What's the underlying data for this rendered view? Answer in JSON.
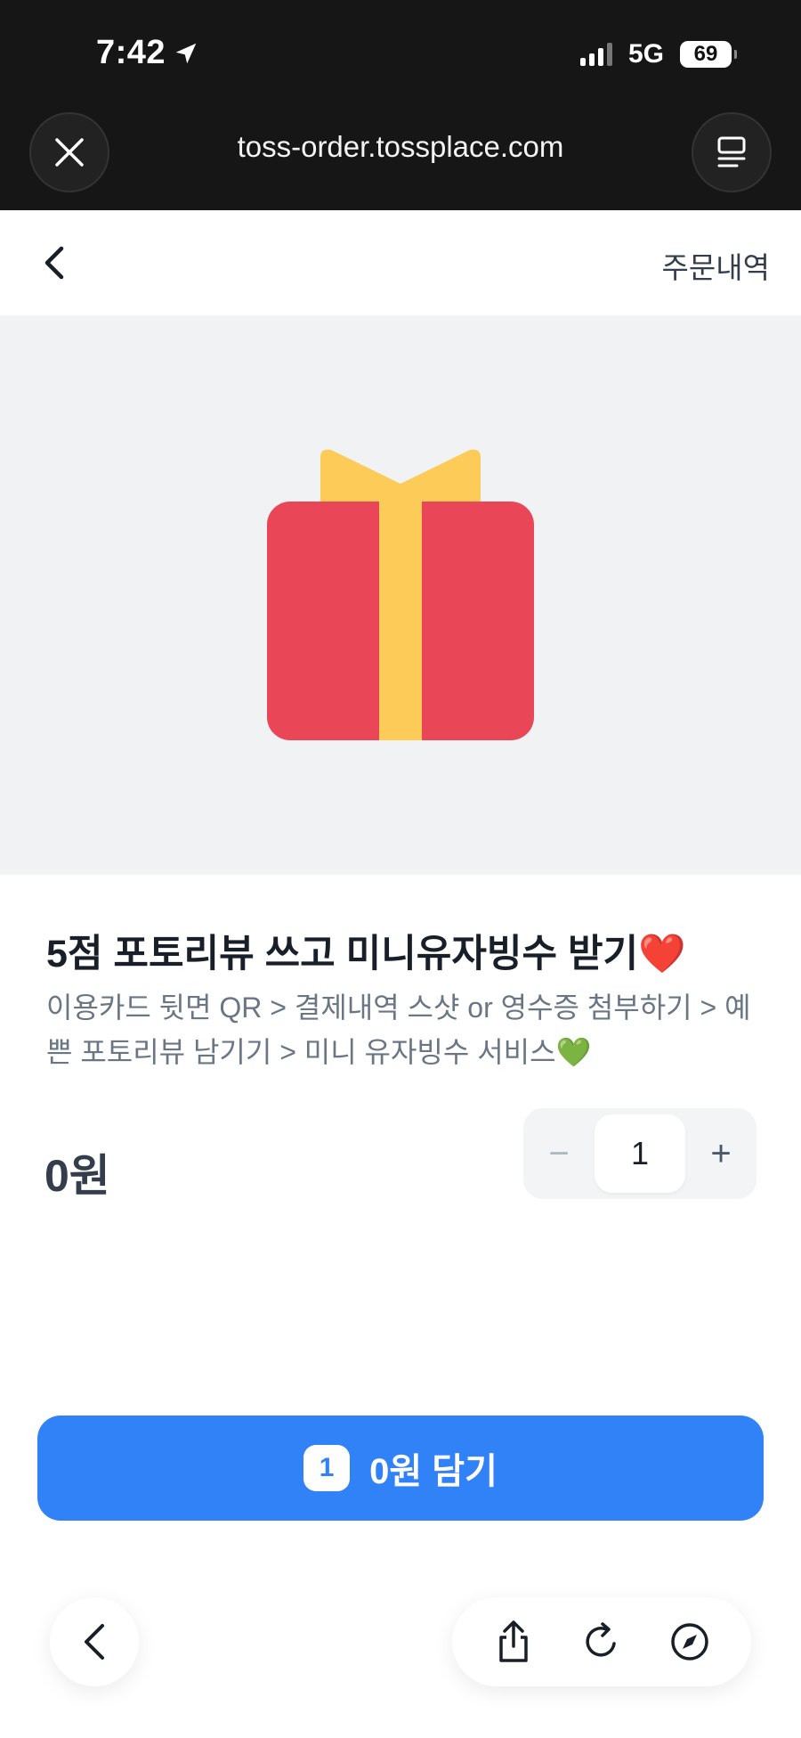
{
  "status_bar": {
    "time": "7:42",
    "network": "5G",
    "battery": "69"
  },
  "browser": {
    "url": "toss-order.tossplace.com"
  },
  "nav": {
    "orders_label": "주문내역"
  },
  "product": {
    "title": "5점 포토리뷰 쓰고 미니유자빙수 받기❤️",
    "description": "이용카드 뒷면 QR > 결제내역 스샷 or 영수증 첨부하기 > 예쁜 포토리뷰 남기기 > 미니 유자빙수 서비스💚",
    "price": "0원",
    "quantity": "1",
    "decrease_symbol": "−",
    "increase_symbol": "+",
    "image_icon": "gift-icon"
  },
  "cart_button": {
    "count": "1",
    "label": "0원 담기"
  },
  "colors": {
    "primary": "#3182f6",
    "gift_box": "#e94657",
    "gift_ribbon": "#fdcb58",
    "hero_bg": "#f1f2f4",
    "chrome_bg": "#161616"
  }
}
